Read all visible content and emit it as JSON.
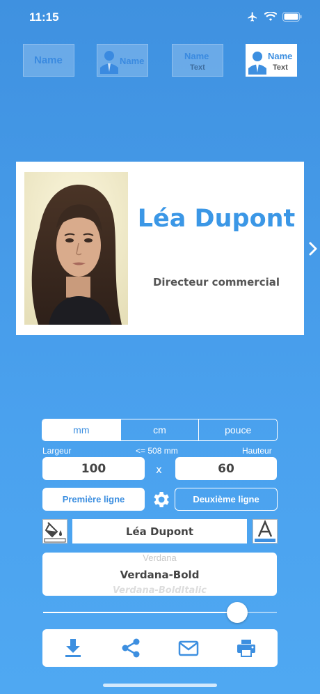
{
  "status_bar": {
    "time": "11:15",
    "icons": [
      "airplane-icon",
      "wifi-icon",
      "battery-icon"
    ]
  },
  "templates": [
    {
      "name": "Name",
      "text": "",
      "with_photo": false,
      "selected": false
    },
    {
      "name": "Name",
      "text": "",
      "with_photo": true,
      "selected": false
    },
    {
      "name": "Name",
      "text": "Text",
      "with_photo": false,
      "selected": false
    },
    {
      "name": "Name",
      "text": "Text",
      "with_photo": true,
      "selected": true
    }
  ],
  "card": {
    "name": "Léa Dupont",
    "title": "Directeur commercial",
    "name_color": "#3b97e6"
  },
  "units": {
    "options": [
      "mm",
      "cm",
      "pouce"
    ],
    "selected": "mm"
  },
  "size": {
    "width_label": "Largeur",
    "limit_label": "<= 508 mm",
    "height_label": "Hauteur",
    "width_value": "100",
    "separator": "x",
    "height_value": "60"
  },
  "lines": {
    "first_label": "Première ligne",
    "second_label": "Deuxième ligne"
  },
  "text_field": {
    "value": "Léa Dupont"
  },
  "fonts": {
    "previous": "Verdana",
    "selected": "Verdana-Bold",
    "next": "Verdana-BoldItalic"
  },
  "font_size_slider": {
    "value": 0.83
  },
  "actions": [
    "download-icon",
    "share-icon",
    "mail-icon",
    "print-icon"
  ],
  "colors": {
    "accent": "#3d8fe0",
    "background_top": "#3f91e0",
    "background_bottom": "#4fa8f2"
  }
}
